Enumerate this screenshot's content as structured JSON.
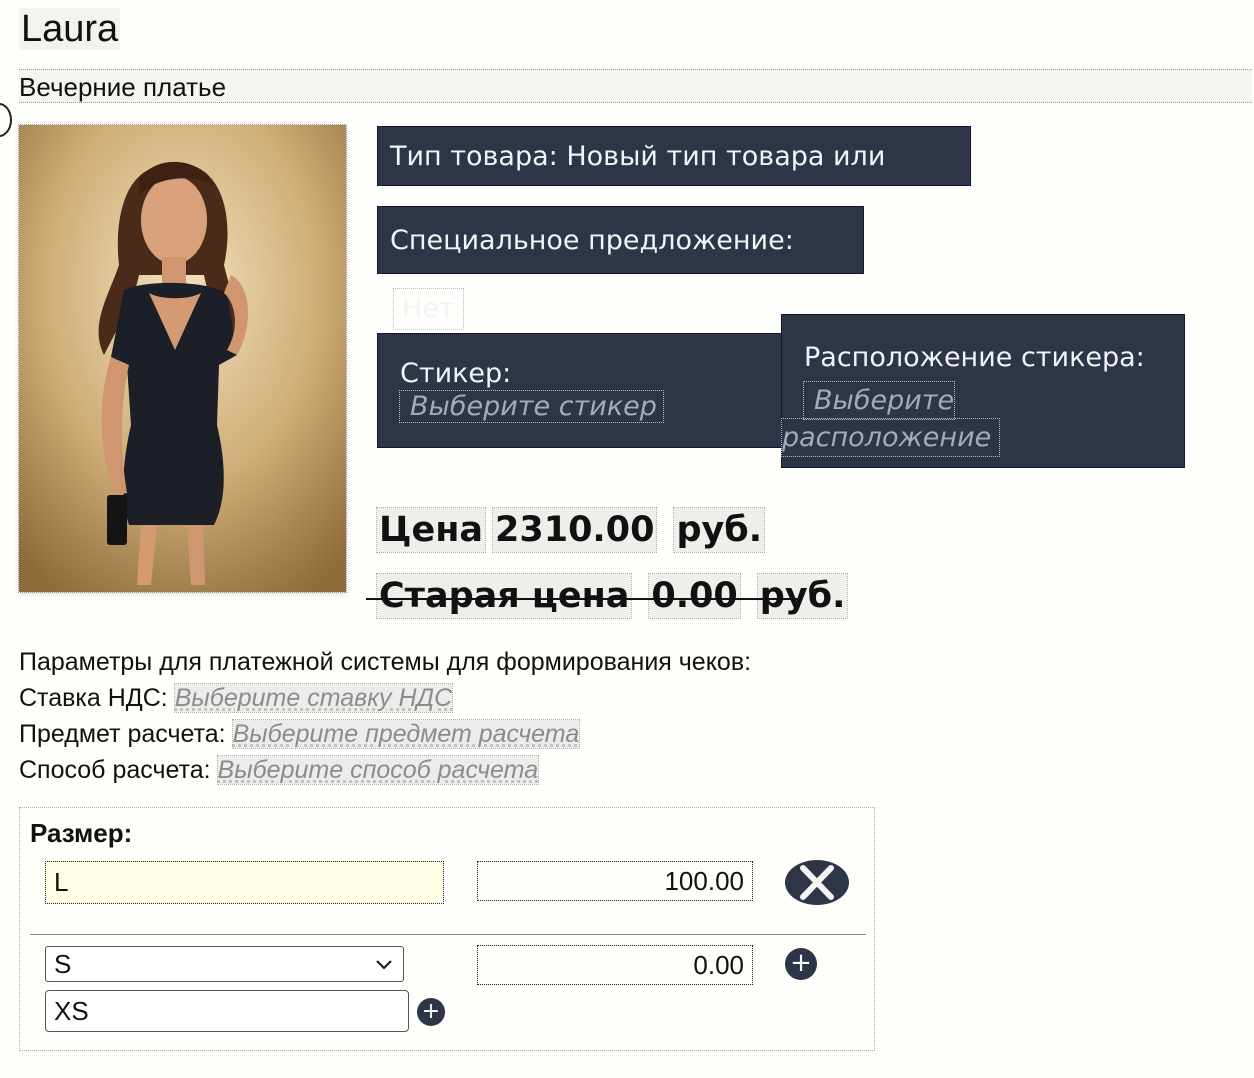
{
  "product": {
    "title": "Laura",
    "subtitle": "Вечерние платье",
    "type_text": "Тип товара: Новый тип товара или услуги",
    "special_label": "Специальное предложение:",
    "special_value": "Нет",
    "sticker_label": "Стикер:",
    "sticker_placeholder": "Выберите стикер",
    "sticker_pos_label": "Расположение стикера:",
    "sticker_pos_placeholder_1": "Выберите",
    "sticker_pos_placeholder_2": "расположение"
  },
  "price": {
    "label": "Цена",
    "value": "2310.00",
    "currency": "руб.",
    "old_label": "Старая цена",
    "old_value": "0.00",
    "old_currency": "руб."
  },
  "payment": {
    "header": "Параметры для платежной системы для формирования чеков:",
    "vat_label": "Ставка НДС:",
    "vat_placeholder": "Выберите ставку НДС",
    "subject_label": "Предмет расчета:",
    "subject_placeholder": "Выберите предмет расчета",
    "method_label": "Способ расчета:",
    "method_placeholder": "Выберите способ расчета"
  },
  "sizes": {
    "label": "Размер:",
    "rows": [
      {
        "size": "L",
        "price": "100.00"
      },
      {
        "size": "S",
        "price": "0.00"
      }
    ],
    "new_size_value": "XS"
  },
  "icons": {
    "remove": "close-icon",
    "add": "plus-icon",
    "select": "chevron-down-icon"
  },
  "colors": {
    "panel": "#2d3547",
    "input_highlight": "#fffde4"
  }
}
